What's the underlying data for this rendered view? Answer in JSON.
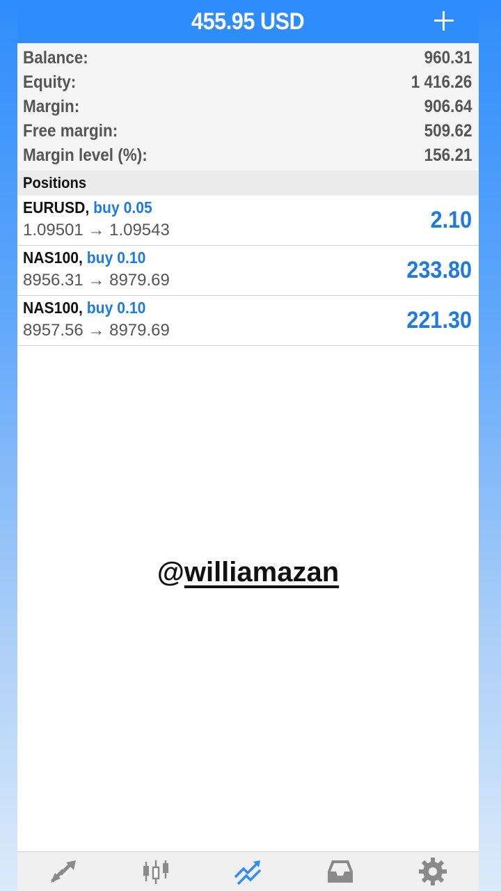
{
  "header": {
    "title": "455.95 USD",
    "add_icon": "plus-icon"
  },
  "summary": [
    {
      "label": "Balance:",
      "value": "960.31"
    },
    {
      "label": "Equity:",
      "value": "1 416.26"
    },
    {
      "label": "Margin:",
      "value": "906.64"
    },
    {
      "label": "Free margin:",
      "value": "509.62"
    },
    {
      "label": "Margin level (%):",
      "value": "156.21"
    }
  ],
  "positions_header": "Positions",
  "positions": [
    {
      "symbol": "EURUSD,",
      "type": "buy 0.05",
      "prices": "1.09501 → 1.09543",
      "profit": "2.10"
    },
    {
      "symbol": "NAS100,",
      "type": "buy 0.10",
      "prices": "8956.31 → 8979.69",
      "profit": "233.80"
    },
    {
      "symbol": "NAS100,",
      "type": "buy 0.10",
      "prices": "8957.56 → 8979.69",
      "profit": "221.30"
    }
  ],
  "watermark": {
    "at": "@",
    "handle": "williamazan"
  },
  "tabbar": {
    "tabs": [
      {
        "icon": "quotes-arrows-icon",
        "active": false
      },
      {
        "icon": "chart-candles-icon",
        "active": false
      },
      {
        "icon": "trade-icon",
        "active": true
      },
      {
        "icon": "inbox-icon",
        "active": false
      },
      {
        "icon": "settings-gear-icon",
        "active": false
      }
    ]
  },
  "colors": {
    "accent": "#2f8dfb",
    "profit_blue": "#1f7ae0",
    "icon_gray": "#8a8a8a"
  }
}
